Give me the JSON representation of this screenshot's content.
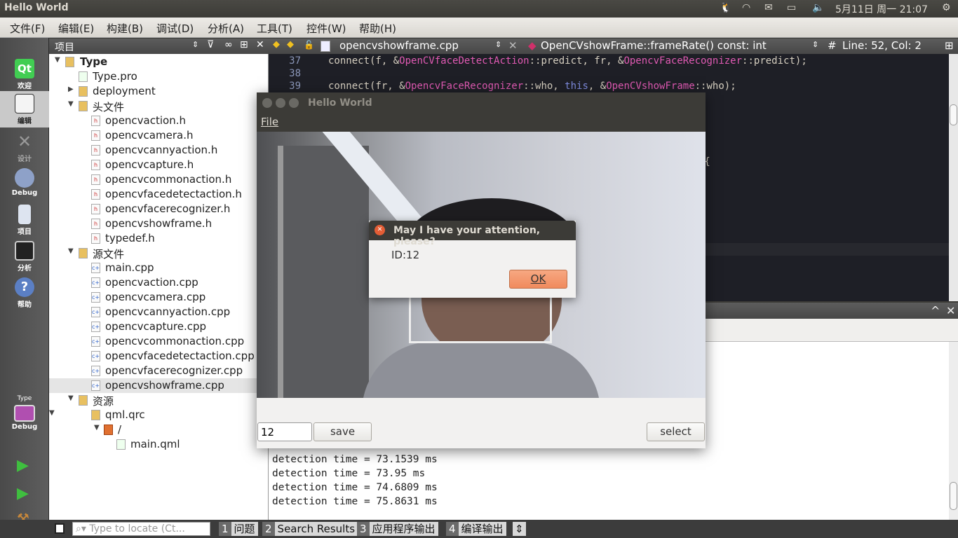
{
  "system": {
    "window_title": "Hello World",
    "clock": "5月11日 周一 21:07",
    "icons": [
      "tux-icon",
      "wifi-icon",
      "mail-icon",
      "battery-icon",
      "volume-icon",
      "power-icon"
    ]
  },
  "menu": [
    "文件(F)",
    "编辑(E)",
    "构建(B)",
    "调试(D)",
    "分析(A)",
    "工具(T)",
    "控件(W)",
    "帮助(H)"
  ],
  "modes": [
    {
      "label": "欢迎",
      "icon": "qt-logo-icon"
    },
    {
      "label": "编辑",
      "icon": "edit-icon"
    },
    {
      "label": "设计",
      "icon": "design-icon"
    },
    {
      "label": "Debug",
      "icon": "bug-icon"
    },
    {
      "label": "项目",
      "icon": "project-icon"
    },
    {
      "label": "分析",
      "icon": "analyze-icon"
    },
    {
      "label": "帮助",
      "icon": "help-icon"
    }
  ],
  "kit": {
    "project": "Type",
    "config": "Debug"
  },
  "project_panel": {
    "title": "项目"
  },
  "tree": [
    {
      "label": "Type",
      "level": 0,
      "arrow": "▼",
      "bold": true
    },
    {
      "label": "Type.pro",
      "level": 1,
      "arrow": ""
    },
    {
      "label": "deployment",
      "level": 1,
      "arrow": "▶"
    },
    {
      "label": "头文件",
      "level": 1,
      "arrow": "▼"
    },
    {
      "label": "opencvaction.h",
      "level": 2
    },
    {
      "label": "opencvcamera.h",
      "level": 2
    },
    {
      "label": "opencvcannyaction.h",
      "level": 2
    },
    {
      "label": "opencvcapture.h",
      "level": 2
    },
    {
      "label": "opencvcommonaction.h",
      "level": 2
    },
    {
      "label": "opencvfacedetectaction.h",
      "level": 2
    },
    {
      "label": "opencvfacerecognizer.h",
      "level": 2
    },
    {
      "label": "opencvshowframe.h",
      "level": 2
    },
    {
      "label": "typedef.h",
      "level": 2
    },
    {
      "label": "源文件",
      "level": 1,
      "arrow": "▼"
    },
    {
      "label": "main.cpp",
      "level": 2
    },
    {
      "label": "opencvaction.cpp",
      "level": 2
    },
    {
      "label": "opencvcamera.cpp",
      "level": 2
    },
    {
      "label": "opencvcannyaction.cpp",
      "level": 2
    },
    {
      "label": "opencvcapture.cpp",
      "level": 2
    },
    {
      "label": "opencvcommonaction.cpp",
      "level": 2
    },
    {
      "label": "opencvfacedetectaction.cpp",
      "level": 2
    },
    {
      "label": "opencvfacerecognizer.cpp",
      "level": 2
    },
    {
      "label": "opencvshowframe.cpp",
      "level": 2,
      "selected": true
    },
    {
      "label": "资源",
      "level": 1,
      "arrow": "▼"
    },
    {
      "label": "qml.qrc",
      "level": 2,
      "arrow": "▼"
    },
    {
      "label": "/",
      "level": 3,
      "arrow": "▼"
    },
    {
      "label": "main.qml",
      "level": 4
    }
  ],
  "editor": {
    "file": "opencvshowframe.cpp",
    "symbol": "OpenCVshowFrame::frameRate() const: int",
    "position": "Line: 52, Col: 2",
    "lines": [
      {
        "n": "37",
        "parts": [
          [
            "",
            "connect(f, &"
          ],
          [
            "cls",
            "OpenCVfaceDetectAction"
          ],
          [
            "",
            "::predict, fr, &"
          ],
          [
            "cls",
            "OpencvFaceRecognizer"
          ],
          [
            "",
            "::predict);"
          ]
        ]
      },
      {
        "n": "38",
        "parts": []
      },
      {
        "n": "39",
        "parts": [
          [
            "",
            "connect(fr, &"
          ],
          [
            "cls",
            "OpencvFaceRecognizer"
          ],
          [
            "",
            "::who, "
          ],
          [
            "kw",
            "this"
          ],
          [
            "",
            ", &"
          ],
          [
            "cls",
            "OpenCVshowFrame"
          ],
          [
            "",
            "::who);"
          ]
        ]
      }
    ],
    "fragment": "e) {"
  },
  "output": {
    "lines": [
      "detection time = 73.1539 ms",
      "detection time = 73.95 ms",
      "detection time = 74.6809 ms",
      "detection time = 75.8631 ms"
    ]
  },
  "bottom": {
    "locate_placeholder": "Type to locate (Ct...",
    "tabs": [
      {
        "n": "1",
        "label": "问题"
      },
      {
        "n": "2",
        "label": "Search Results"
      },
      {
        "n": "3",
        "label": "应用程序输出"
      },
      {
        "n": "4",
        "label": "编译输出"
      }
    ]
  },
  "app": {
    "title": "Hello World",
    "menu": "File",
    "id_value": "12",
    "save": "save",
    "select": "select"
  },
  "dialog": {
    "title": "May I have your attention, please?",
    "message": "ID:12",
    "ok": "OK"
  }
}
